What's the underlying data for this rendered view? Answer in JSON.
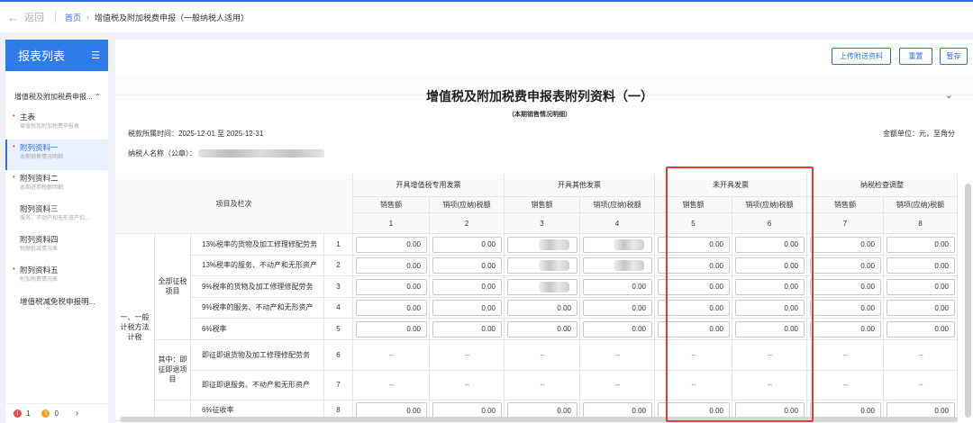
{
  "topbar": {
    "back": "返回",
    "breadcrumb_home": "首页",
    "breadcrumb_sep": "›",
    "breadcrumb_current": "增值税及附加税费申报（一般纳税人适用）"
  },
  "sidebar": {
    "title": "报表列表",
    "group": "增值税及附加税费申报...",
    "items": [
      {
        "label": "主表",
        "sub": "增值税及附加税费申报表",
        "required": true,
        "active": false
      },
      {
        "label": "附列资料一",
        "sub": "本期销售情况明细",
        "required": true,
        "active": true
      },
      {
        "label": "附列资料二",
        "sub": "本期进项税额明细",
        "required": true,
        "active": false
      },
      {
        "label": "附列资料三",
        "sub": "服务、不动产和无形资产扣...",
        "required": false,
        "active": false
      },
      {
        "label": "附列资料四",
        "sub": "税额抵减情况表",
        "required": false,
        "active": false
      },
      {
        "label": "附列资料五",
        "sub": "附加税费情况表",
        "required": true,
        "active": false
      }
    ],
    "last_item": "增值税减免税申报明...",
    "footer": {
      "errors": "1",
      "warnings": "0",
      "next": "›"
    }
  },
  "actions": {
    "upload": "上传附送资料",
    "reset": "重置",
    "save": "暂存"
  },
  "form": {
    "title": "增值税及附加税费申报表附列资料（一）",
    "subtitle": "（本期销售情况明细）",
    "period": "税款所属时间：2025-12-01 至 2025-12-31",
    "unit": "金额单位：元，至角分",
    "taxpayer_label": "纳税人名称（公章）："
  },
  "table": {
    "item_header": "项目及栏次",
    "groups": [
      "开具增值税专用发票",
      "开具其他发票",
      "未开具发票",
      "纳税检查调整"
    ],
    "subcols": [
      "销售额",
      "销项(应纳)税额"
    ],
    "col_numbers": [
      "1",
      "2",
      "3",
      "4",
      "5",
      "6",
      "7",
      "8"
    ],
    "section": "一、一般计税方法计税",
    "sub_all": "全部征税项目",
    "sub_refund": "其中：即征即退项目",
    "rows": [
      {
        "label": "13%税率的货物及加工修理修配劳务",
        "num": "1",
        "values": [
          "0.00",
          "0.00",
          "",
          "",
          "0.00",
          "0.00",
          "0.00",
          "0.00"
        ]
      },
      {
        "label": "13%税率的服务、不动产和无形资产",
        "num": "2",
        "values": [
          "0.00",
          "0.00",
          "",
          "",
          "0.00",
          "0.00",
          "0.00",
          "0.00"
        ]
      },
      {
        "label": "9%税率的货物及加工修理修配劳务",
        "num": "3",
        "values": [
          "0.00",
          "0.00",
          "",
          "0.00",
          "0.00",
          "0.00",
          "0.00",
          "0.00"
        ]
      },
      {
        "label": "9%税率的服务、不动产和无形资产",
        "num": "4",
        "values": [
          "0.00",
          "0.00",
          "0.00",
          "0.00",
          "0.00",
          "0.00",
          "0.00",
          "0.00"
        ]
      },
      {
        "label": "6%税率",
        "num": "5",
        "values": [
          "0.00",
          "0.00",
          "0.00",
          "0.00",
          "0.00",
          "0.00",
          "0.00",
          "0.00"
        ]
      },
      {
        "label": "即征即退货物及加工修理修配劳务",
        "num": "6",
        "values": [
          "--",
          "--",
          "--",
          "--",
          "--",
          "--",
          "--",
          "--"
        ]
      },
      {
        "label": "即征即退服务、不动产和无形资产",
        "num": "7",
        "values": [
          "--",
          "--",
          "--",
          "--",
          "--",
          "--",
          "--",
          "--"
        ]
      },
      {
        "label": "6%征收率",
        "num": "8",
        "values": [
          "0.00",
          "0.00",
          "0.00",
          "0.00",
          "0.00",
          "0.00",
          "0.00",
          "0.00"
        ]
      }
    ]
  },
  "colors": {
    "primary": "#2e6ee8",
    "highlight_box": "#e03b3b",
    "required_star": "#e84a4a"
  }
}
